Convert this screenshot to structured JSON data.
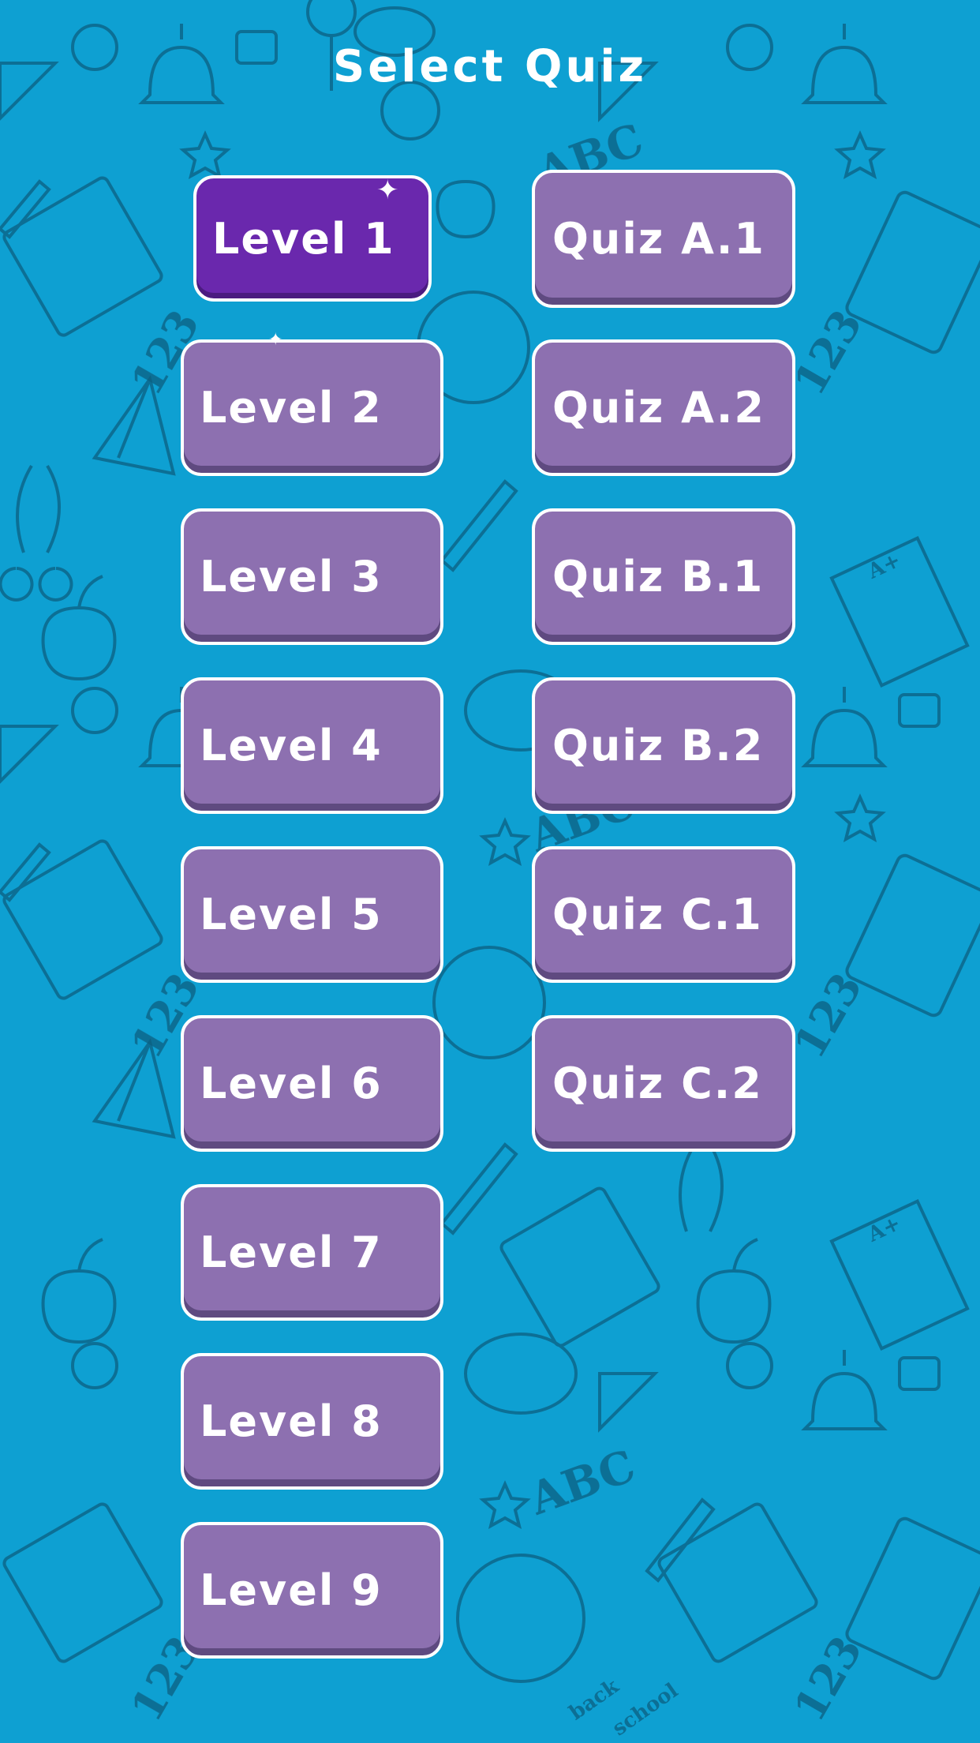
{
  "header": {
    "title": "Select Quiz"
  },
  "levels": [
    {
      "label": "Level 1",
      "selected": true
    },
    {
      "label": "Level 2"
    },
    {
      "label": "Level 3"
    },
    {
      "label": "Level 4"
    },
    {
      "label": "Level 5"
    },
    {
      "label": "Level 6"
    },
    {
      "label": "Level 7"
    },
    {
      "label": "Level 8"
    },
    {
      "label": "Level 9"
    }
  ],
  "quizzes": [
    {
      "label": "Quiz A.1"
    },
    {
      "label": "Quiz A.2"
    },
    {
      "label": "Quiz B.1"
    },
    {
      "label": "Quiz B.2"
    },
    {
      "label": "Quiz C.1"
    },
    {
      "label": "Quiz C.2"
    }
  ],
  "background": {
    "pattern_text": [
      "ABC",
      "123",
      "A+",
      "back",
      "school"
    ]
  },
  "colors": {
    "background": "#0ea0d2",
    "button": "#8d70b0",
    "button_selected": "#6a28ad",
    "button_border": "#ffffff",
    "text": "#ffffff"
  }
}
